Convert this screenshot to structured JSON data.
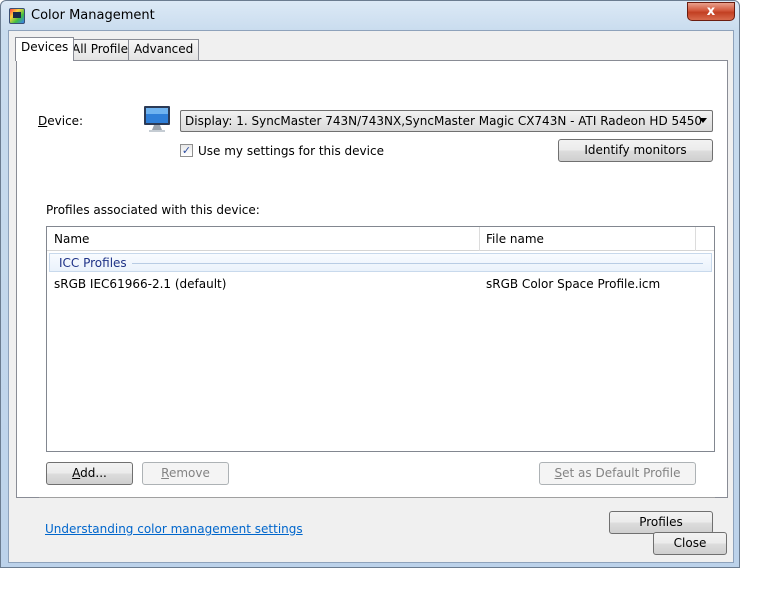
{
  "window": {
    "title": "Color Management",
    "close_glyph": "x"
  },
  "tabs": [
    {
      "label": "Devices",
      "active": true
    },
    {
      "label": "All Profiles",
      "active": false
    },
    {
      "label": "Advanced",
      "active": false
    }
  ],
  "device": {
    "label": "Device:",
    "icon": "monitor-icon",
    "selected": "Display: 1. SyncMaster 743N/743NX,SyncMaster Magic CX743N - ATI Radeon HD 5450",
    "use_settings_label": "Use my settings for this device",
    "use_settings_checked": true,
    "identify_button": "Identify monitors"
  },
  "profiles": {
    "section_label": "Profiles associated with this device:",
    "columns": [
      "Name",
      "File name"
    ],
    "group": "ICC Profiles",
    "rows": [
      {
        "name": "sRGB IEC61966-2.1 (default)",
        "file": "sRGB Color Space Profile.icm"
      }
    ],
    "add_button": "Add...",
    "remove_button": "Remove",
    "set_default_button": "Set as Default Profile"
  },
  "footer": {
    "link": "Understanding color management settings",
    "profiles_button": "Profiles",
    "close_button": "Close"
  },
  "colors": {
    "accent": "#0066cc",
    "group_title": "#1e3287",
    "close_button": "#c23f22"
  }
}
